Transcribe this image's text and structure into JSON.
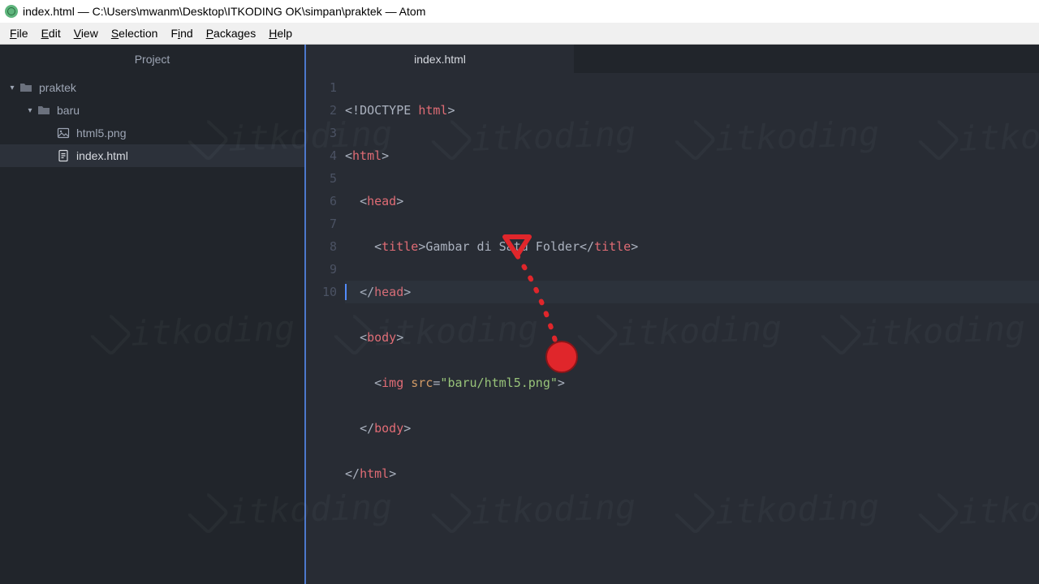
{
  "window": {
    "title": "index.html — C:\\Users\\mwanm\\Desktop\\ITKODING OK\\simpan\\praktek — Atom"
  },
  "menu": {
    "file": "File",
    "edit": "Edit",
    "view": "View",
    "selection": "Selection",
    "find": "Find",
    "packages": "Packages",
    "help": "Help"
  },
  "sidebar": {
    "title": "Project",
    "items": [
      {
        "name": "praktek",
        "type": "folder",
        "depth": 0,
        "expanded": true
      },
      {
        "name": "baru",
        "type": "folder",
        "depth": 1,
        "expanded": true
      },
      {
        "name": "html5.png",
        "type": "image",
        "depth": 2
      },
      {
        "name": "index.html",
        "type": "file",
        "depth": 2,
        "selected": true
      }
    ]
  },
  "editor": {
    "tab": "index.html",
    "line_numbers": [
      "1",
      "2",
      "3",
      "4",
      "5",
      "6",
      "7",
      "8",
      "9",
      "10"
    ],
    "code": {
      "l1": {
        "indent": "",
        "open": "<!",
        "tag": "DOCTYPE",
        "space": " ",
        "attr": "html",
        "close": ">"
      },
      "l2": {
        "indent": "",
        "open": "<",
        "tag": "html",
        "close": ">"
      },
      "l3": {
        "indent": "  ",
        "open": "<",
        "tag": "head",
        "close": ">"
      },
      "l4": {
        "indent": "    ",
        "open1": "<",
        "tag1": "title",
        "close1": ">",
        "text": "Gambar di Satu Folder",
        "open2": "</",
        "tag2": "title",
        "close2": ">"
      },
      "l5": {
        "indent": "  ",
        "open": "</",
        "tag": "head",
        "close": ">"
      },
      "l6": {
        "indent": "  ",
        "open": "<",
        "tag": "body",
        "close": ">"
      },
      "l7": {
        "indent": "    ",
        "open": "<",
        "tag": "img",
        "space": " ",
        "attr": "src",
        "eq": "=",
        "q1": "\"",
        "val": "baru/html5.png",
        "q2": "\"",
        "close": ">"
      },
      "l8": {
        "indent": "  ",
        "open": "</",
        "tag": "body",
        "close": ">"
      },
      "l9": {
        "indent": "",
        "open": "</",
        "tag": "html",
        "close": ">"
      }
    }
  },
  "watermark": {
    "text": "itkoding"
  }
}
